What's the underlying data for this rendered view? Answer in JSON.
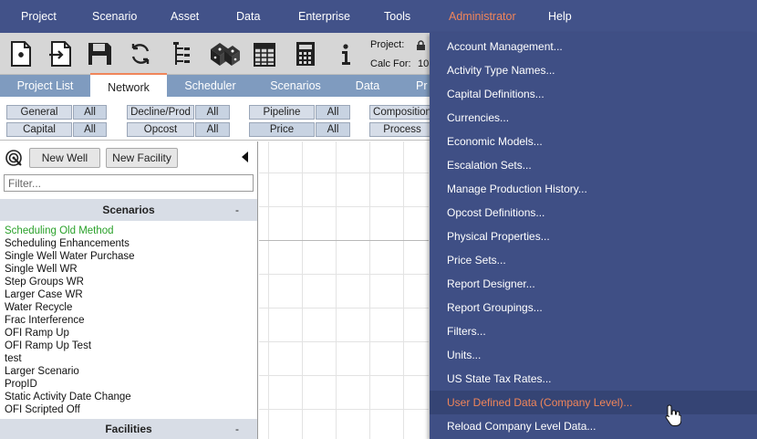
{
  "menubar": {
    "items": [
      {
        "label": "Project"
      },
      {
        "label": "Scenario"
      },
      {
        "label": "Asset"
      },
      {
        "label": "Data"
      },
      {
        "label": "Enterprise"
      },
      {
        "label": "Tools"
      },
      {
        "label": "Administrator",
        "active": true
      },
      {
        "label": "Help"
      }
    ]
  },
  "toolbar": {
    "icons": [
      "new-file-icon",
      "import-icon",
      "save-icon",
      "refresh-icon",
      "tree-icon",
      "dice-icon",
      "spreadsheet-icon",
      "calculator-icon",
      "info-icon"
    ],
    "project_label": "Project:",
    "calc_for_label": "Calc For:",
    "calc_for_value": "10"
  },
  "tabs": [
    {
      "label": "Project List"
    },
    {
      "label": "Network",
      "active": true
    },
    {
      "label": "Scheduler"
    },
    {
      "label": "Scenarios"
    },
    {
      "label": "Data"
    },
    {
      "label": "Pr"
    }
  ],
  "filters": {
    "general": "General",
    "general_all": "All",
    "capital": "Capital",
    "capital_all": "All",
    "decline": "Decline/Prod",
    "decline_all": "All",
    "opcost": "Opcost",
    "opcost_all": "All",
    "pipeline": "Pipeline",
    "pipeline_all": "All",
    "price": "Price",
    "price_all": "All",
    "composition": "Composition",
    "process": "Process"
  },
  "leftpanel": {
    "new_well": "New Well",
    "new_facility": "New Facility",
    "filter_placeholder": "Filter...",
    "scenarios_header": "Scenarios",
    "collapse_symbol": "-",
    "facilities_header": "Facilities",
    "scenarios": [
      {
        "name": "Scheduling Old Method",
        "selected": true
      },
      {
        "name": "Scheduling Enhancements"
      },
      {
        "name": "Single Well Water Purchase"
      },
      {
        "name": "Single Well WR"
      },
      {
        "name": "Step Groups WR"
      },
      {
        "name": "Larger Case WR"
      },
      {
        "name": "Water Recycle"
      },
      {
        "name": "Frac Interference"
      },
      {
        "name": "OFI Ramp Up"
      },
      {
        "name": "OFI Ramp Up Test"
      },
      {
        "name": "test"
      },
      {
        "name": "Larger Scenario"
      },
      {
        "name": "PropID"
      },
      {
        "name": "Static Activity Date Change"
      },
      {
        "name": "OFI Scripted Off"
      }
    ]
  },
  "admin_menu": {
    "items": [
      {
        "label": "Account Management..."
      },
      {
        "label": "Activity Type Names..."
      },
      {
        "label": "Capital Definitions..."
      },
      {
        "label": "Currencies..."
      },
      {
        "label": "Economic Models..."
      },
      {
        "label": "Escalation Sets..."
      },
      {
        "label": "Manage Production History..."
      },
      {
        "label": "Opcost Definitions..."
      },
      {
        "label": "Physical Properties..."
      },
      {
        "label": "Price Sets..."
      },
      {
        "label": "Report Designer..."
      },
      {
        "label": "Report Groupings..."
      },
      {
        "label": "Filters..."
      },
      {
        "label": "Units..."
      },
      {
        "label": "US State Tax Rates..."
      },
      {
        "label": "User Defined Data (Company Level)...",
        "hover": true
      },
      {
        "label": "Reload Company Level Data..."
      }
    ]
  },
  "colors": {
    "menubar_bg": "#425289",
    "accent": "#f0855a",
    "tab_bar": "#7f9bbf",
    "selected_scenario": "#2aa12a"
  }
}
